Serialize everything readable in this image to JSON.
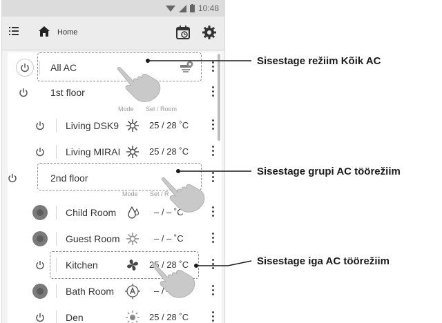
{
  "status": {
    "time": "10:48"
  },
  "toolbar": {
    "title": "Home"
  },
  "list": {
    "all_ac_label": "All AC",
    "floor1_label": "1st floor",
    "floor2_label": "2nd floor",
    "subheader_mode": "Mode",
    "subheader_set_room": "Set / Room",
    "subheader_set_room_partial": "Set / R",
    "rooms": [
      {
        "name": "Living DSK9",
        "temp": "25 / 28 ˚C",
        "mode": "heat"
      },
      {
        "name": "Living MIRAI",
        "temp": "25 / 28 ˚C",
        "mode": "heat"
      },
      {
        "name": "Child Room",
        "temp": "– / –  ˚C",
        "mode": "dry"
      },
      {
        "name": "Guest Room",
        "temp": "– / –  ˚C",
        "mode": "heat"
      },
      {
        "name": "Kitchen",
        "temp": "25 / 28 ˚C",
        "mode": "fan"
      },
      {
        "name": "Bath Room",
        "temp": "– / –  ˚C",
        "mode": "auto"
      },
      {
        "name": "Den",
        "temp": "25 / 28 ˚C",
        "mode": "cool"
      }
    ]
  },
  "callouts": {
    "all_ac": "Sisestage režiim Kõik AC",
    "group": "Sisestage grupi AC töörežiim",
    "each": "Sisestage iga AC töörežiim"
  },
  "colors": {
    "callout_text": "#1a1a1a",
    "power_off_fill": "#7a7a7a"
  }
}
